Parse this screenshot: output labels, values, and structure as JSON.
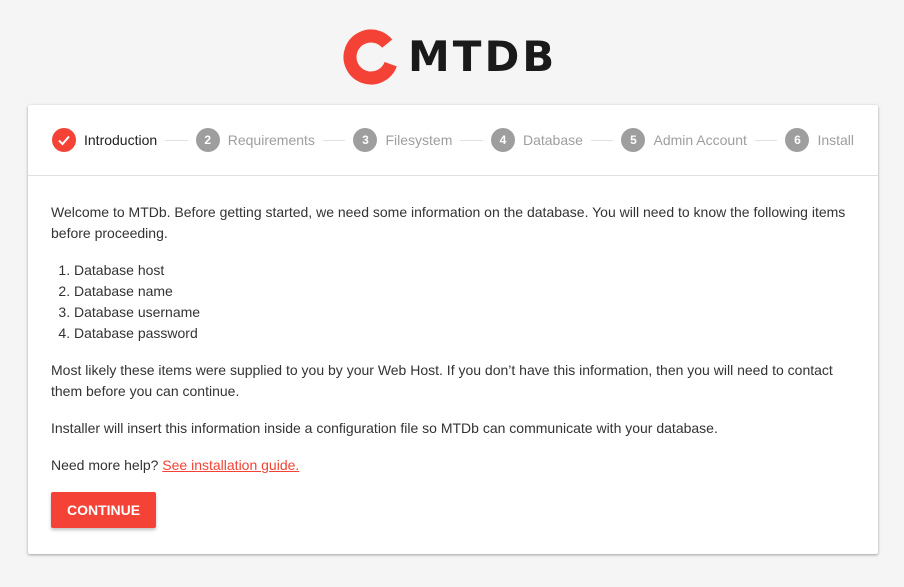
{
  "logo": {
    "text": "MTDB",
    "brand_color": "#f44336",
    "icon": "mtdb-logo-icon"
  },
  "stepper": {
    "steps": [
      {
        "number": "",
        "label": "Introduction",
        "state": "done",
        "icon": "checkmark-icon"
      },
      {
        "number": "2",
        "label": "Requirements",
        "state": "pending"
      },
      {
        "number": "3",
        "label": "Filesystem",
        "state": "pending"
      },
      {
        "number": "4",
        "label": "Database",
        "state": "pending"
      },
      {
        "number": "5",
        "label": "Admin Account",
        "state": "pending"
      },
      {
        "number": "6",
        "label": "Install",
        "state": "pending"
      }
    ]
  },
  "content": {
    "intro": "Welcome to MTDb. Before getting started, we need some information on the database. You will need to know the following items before proceeding.",
    "items": [
      "Database host",
      "Database name",
      "Database username",
      "Database password"
    ],
    "paragraph_host": "Most likely these items were supplied to you by your Web Host. If you don’t have this information, then you will need to contact them before you can continue.",
    "paragraph_installer": "Installer will insert this information inside a configuration file so MTDb can communicate with your database.",
    "help_prefix": "Need more help?",
    "help_link": "See installation guide."
  },
  "actions": {
    "continue_label": "CONTINUE"
  },
  "colors": {
    "accent": "#f44336",
    "inactive_step": "#9e9e9e",
    "background": "#f5f5f5"
  }
}
